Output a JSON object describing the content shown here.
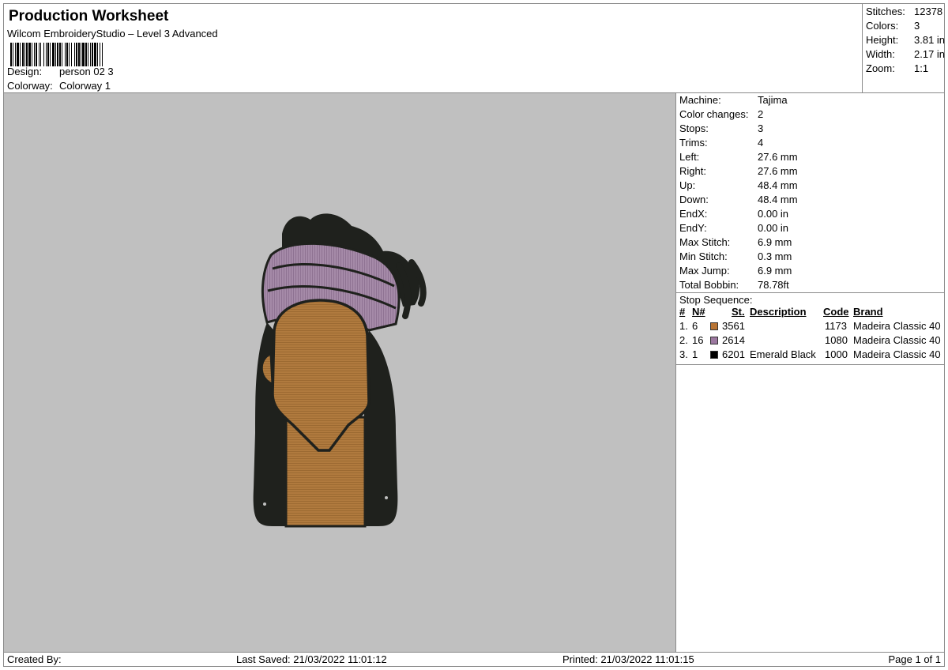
{
  "header": {
    "title": "Production Worksheet",
    "software": "Wilcom EmbroideryStudio – Level 3 Advanced",
    "design_label": "Design:",
    "design_value": "person 02 3",
    "colorway_label": "Colorway:",
    "colorway_value": "Colorway 1"
  },
  "stats": [
    {
      "label": "Stitches:",
      "value": "12378"
    },
    {
      "label": "Colors:",
      "value": "3"
    },
    {
      "label": "Height:",
      "value": "3.81 in"
    },
    {
      "label": "Width:",
      "value": "2.17 in"
    },
    {
      "label": "Zoom:",
      "value": "1:1"
    }
  ],
  "machine": [
    {
      "label": "Machine:",
      "value": "Tajima"
    },
    {
      "label": "Color changes:",
      "value": "2"
    },
    {
      "label": "Stops:",
      "value": "3"
    },
    {
      "label": "Trims:",
      "value": "4"
    },
    {
      "label": "Left:",
      "value": "27.6 mm"
    },
    {
      "label": "Right:",
      "value": "27.6 mm"
    },
    {
      "label": "Up:",
      "value": "48.4 mm"
    },
    {
      "label": "Down:",
      "value": "48.4 mm"
    },
    {
      "label": "EndX:",
      "value": "0.00 in"
    },
    {
      "label": "EndY:",
      "value": "0.00 in"
    },
    {
      "label": "Max Stitch:",
      "value": "6.9 mm"
    },
    {
      "label": "Min Stitch:",
      "value": "0.3 mm"
    },
    {
      "label": "Max Jump:",
      "value": "6.9 mm"
    },
    {
      "label": "Total Bobbin:",
      "value": "78.78ft"
    }
  ],
  "stop_sequence": {
    "title": "Stop Sequence:",
    "headers": {
      "num": "#",
      "n": "N#",
      "st": "St.",
      "description": "Description",
      "code": "Code",
      "brand": "Brand"
    },
    "rows": [
      {
        "num": "1.",
        "n": "6",
        "color": "#b87433",
        "st": "3561",
        "description": "",
        "code": "1173",
        "brand": "Madeira Classic 40"
      },
      {
        "num": "2.",
        "n": "16",
        "color": "#9c78a0",
        "st": "2614",
        "description": "",
        "code": "1080",
        "brand": "Madeira Classic 40"
      },
      {
        "num": "3.",
        "n": "1",
        "color": "#000000",
        "st": "6201",
        "description": "Emerald Black",
        "code": "1000",
        "brand": "Madeira Classic 40"
      }
    ]
  },
  "footer": {
    "created_by": "Created By:",
    "last_saved": "Last Saved: 21/03/2022 11:01:12",
    "printed": "Printed: 21/03/2022 11:01:15",
    "page": "Page 1 of 1"
  },
  "colors": {
    "canvas_bg": "#c0c0c0",
    "skin": "#b07a3e",
    "turban": "#a58aa8",
    "hair": "#1f211d"
  }
}
